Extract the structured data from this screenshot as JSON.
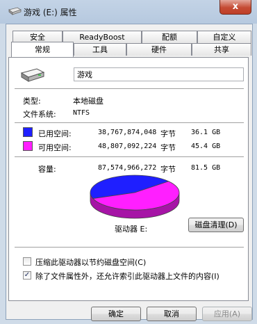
{
  "window": {
    "title": "游戏 (E:) 属性",
    "close_label": "x"
  },
  "tabs_top": [
    {
      "label": "安全"
    },
    {
      "label": "ReadyBoost"
    },
    {
      "label": "配额"
    },
    {
      "label": "自定义"
    }
  ],
  "tabs_bottom": [
    {
      "label": "常规"
    },
    {
      "label": "工具"
    },
    {
      "label": "硬件"
    },
    {
      "label": "共享"
    }
  ],
  "general": {
    "drive_name": "游戏",
    "type_label": "类型:",
    "type_value": "本地磁盘",
    "fs_label": "文件系统:",
    "fs_value": "NTFS",
    "used": {
      "label": "已用空间:",
      "bytes": "38,767,874,048",
      "unit": "字节",
      "size": "36.1 GB",
      "color": "#1f1fff"
    },
    "free": {
      "label": "可用空间:",
      "bytes": "48,807,092,224",
      "unit": "字节",
      "size": "45.4 GB",
      "color": "#ff1fff"
    },
    "capacity": {
      "label": "容量:",
      "bytes": "87,574,966,272",
      "unit": "字节",
      "size": "81.5 GB"
    },
    "drive_label": "驱动器 E:",
    "cleanup_button": "磁盘清理(D)",
    "compress_label": "压缩此驱动器以节约磁盘空间(C)",
    "compress_checked": false,
    "index_label": "除了文件属性外，还允许索引此驱动器上文件的内容(I)",
    "index_checked": true,
    "checkmark": "✓"
  },
  "chart_data": {
    "type": "pie",
    "slices": [
      {
        "name": "已用空间",
        "value": 36.1,
        "color": "#1f1fff"
      },
      {
        "name": "可用空间",
        "value": 45.4,
        "color": "#ff1fff"
      }
    ]
  },
  "buttons": {
    "ok": "确定",
    "cancel": "取消",
    "apply": "应用(A)"
  }
}
